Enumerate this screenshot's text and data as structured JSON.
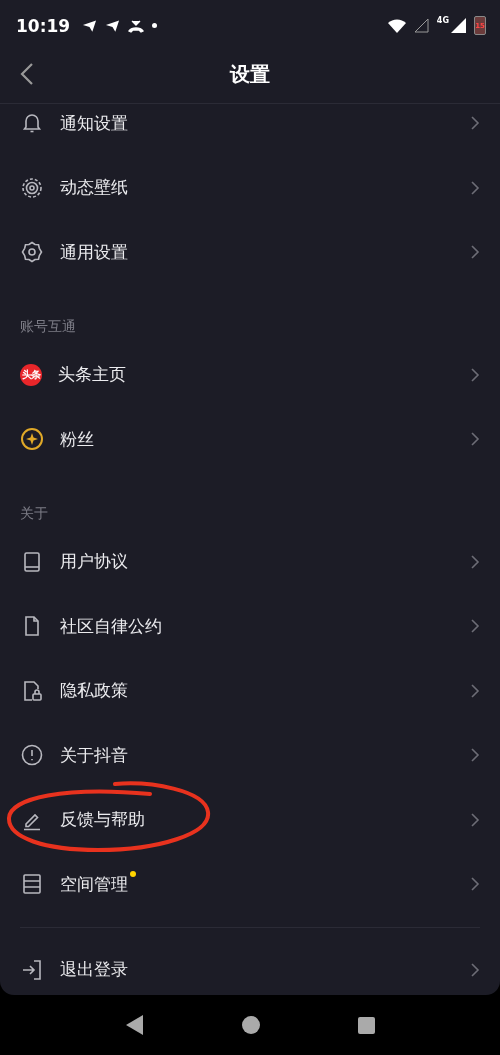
{
  "status_bar": {
    "time": "10:19",
    "network": "4G",
    "battery": "15"
  },
  "header": {
    "title": "设置"
  },
  "sections": [
    {
      "items": [
        {
          "label": "通知设置"
        },
        {
          "label": "动态壁纸"
        },
        {
          "label": "通用设置"
        }
      ]
    },
    {
      "title": "账号互通",
      "items": [
        {
          "label": "头条主页",
          "logo_text": "头条"
        },
        {
          "label": "粉丝"
        }
      ]
    },
    {
      "title": "关于",
      "items": [
        {
          "label": "用户协议"
        },
        {
          "label": "社区自律公约"
        },
        {
          "label": "隐私政策"
        },
        {
          "label": "关于抖音"
        },
        {
          "label": "反馈与帮助",
          "circled": true
        },
        {
          "label": "空间管理",
          "dot": true
        }
      ]
    },
    {
      "divider": true,
      "items": [
        {
          "label": "退出登录"
        }
      ]
    }
  ]
}
